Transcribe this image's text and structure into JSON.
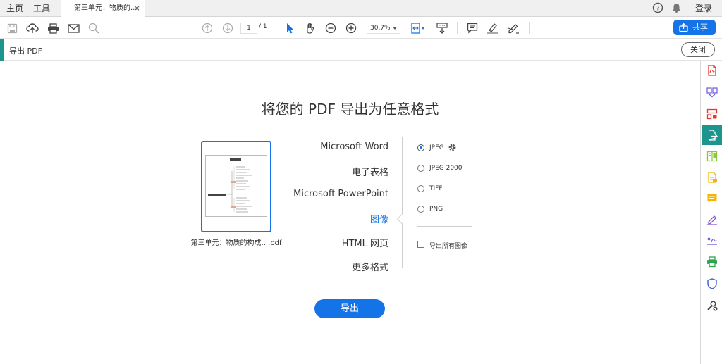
{
  "topbar": {
    "home": "主页",
    "tools": "工具",
    "doc_tab": "第三单元：物质的...",
    "close_tab": "×",
    "login": "登录"
  },
  "toolbar": {
    "page_current": "1",
    "page_total": "/ 1",
    "zoom": "30.7%",
    "share": "共享"
  },
  "panel": {
    "title": "导出 PDF",
    "close": "关闭"
  },
  "main": {
    "heading": "将您的 PDF 导出为任意格式",
    "file_name": "第三单元：物质的构成....pdf",
    "formats": [
      "Microsoft Word",
      "电子表格",
      "Microsoft PowerPoint",
      "图像",
      "HTML 网页",
      "更多格式"
    ],
    "selected_format": "图像",
    "image_options": [
      "JPEG",
      "JPEG 2000",
      "TIFF",
      "PNG"
    ],
    "selected_image_option": "JPEG",
    "export_all_images": "导出所有图像",
    "export_button": "导出"
  },
  "colors": {
    "accent": "#1473e6",
    "teal": "#1c958f"
  },
  "icons": {
    "toolbar": [
      "save-icon",
      "cloud-upload-icon",
      "print-icon",
      "email-icon",
      "zoom-search-icon",
      "page-up-icon",
      "page-down-icon",
      "select-cursor-icon",
      "hand-icon",
      "zoom-out-icon",
      "zoom-in-icon",
      "fit-page-icon",
      "scroll-mode-icon",
      "comment-icon",
      "highlight-icon",
      "sign-icon"
    ],
    "sidebar": [
      "create-pdf-icon",
      "combine-files-icon",
      "organize-pages-icon",
      "export-pdf-icon",
      "edit-pdf-icon",
      "scan-ocr-icon",
      "comment-tool-icon",
      "fill-sign-icon",
      "request-signature-icon",
      "print-production-icon",
      "protect-icon",
      "more-tools-icon"
    ]
  }
}
